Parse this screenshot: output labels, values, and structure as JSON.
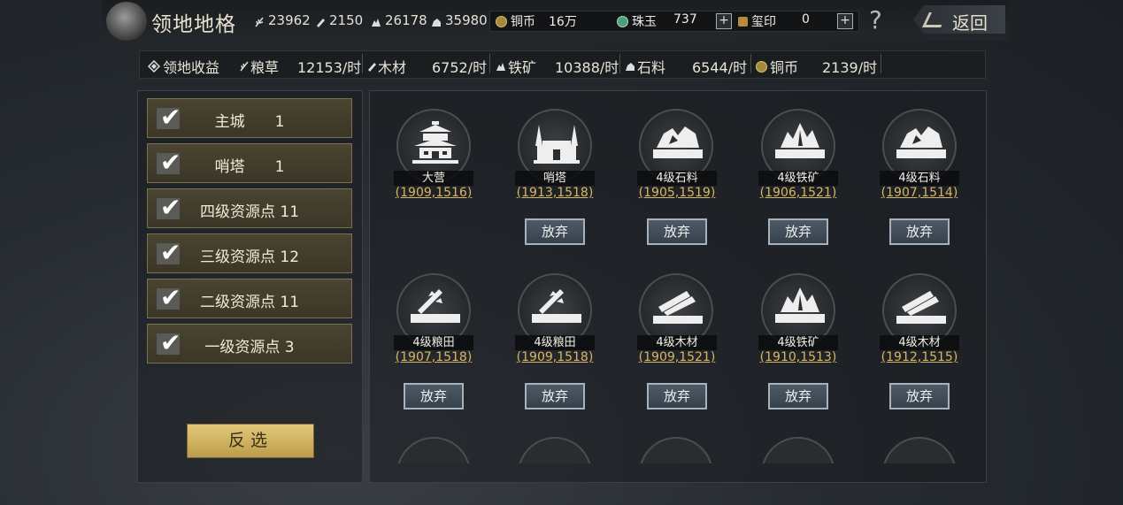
{
  "header": {
    "title": "领地地格",
    "back_label": "返回",
    "help": "?"
  },
  "resources": [
    {
      "icon": "grain-icon",
      "value": "23962"
    },
    {
      "icon": "wood-icon",
      "value": "2150"
    },
    {
      "icon": "iron-icon",
      "value": "26178"
    },
    {
      "icon": "stone-icon",
      "value": "35980"
    }
  ],
  "currencies": [
    {
      "icon": "copper-coin-icon",
      "label": "铜币",
      "value": "16万"
    },
    {
      "icon": "jade-icon",
      "label": "珠玉",
      "value": "737"
    },
    {
      "icon": "seal-icon",
      "label": "玺印",
      "value": "0"
    }
  ],
  "plus": "+",
  "income": {
    "title": "领地收益",
    "items": [
      {
        "icon": "grain-icon",
        "label": "粮草",
        "value": "12153/时"
      },
      {
        "icon": "wood-icon",
        "label": "木材",
        "value": "6752/时"
      },
      {
        "icon": "iron-icon",
        "label": "铁矿",
        "value": "10388/时"
      },
      {
        "icon": "stone-icon",
        "label": "石料",
        "value": "6544/时"
      },
      {
        "icon": "copper-coin-icon",
        "label": "铜币",
        "value": "2139/时"
      }
    ]
  },
  "filters": [
    {
      "label": "主城　　1",
      "checked": true
    },
    {
      "label": "哨塔　　1",
      "checked": true
    },
    {
      "label": "四级资源点 11",
      "checked": true
    },
    {
      "label": "三级资源点 12",
      "checked": true
    },
    {
      "label": "二级资源点 11",
      "checked": true
    },
    {
      "label": "一级资源点 3",
      "checked": true
    }
  ],
  "check_mark": "✔",
  "invert_label": "反选",
  "abandon_label": "放弃",
  "buildings": [
    {
      "name": "大营",
      "coord": "(1909,1516)",
      "icon": "camp-icon",
      "abandon": false
    },
    {
      "name": "哨塔",
      "coord": "(1913,1518)",
      "icon": "watchtower-icon",
      "abandon": true
    },
    {
      "name": "4级石料",
      "coord": "(1905,1519)",
      "icon": "stone-icon",
      "abandon": true
    },
    {
      "name": "4级铁矿",
      "coord": "(1906,1521)",
      "icon": "iron-icon",
      "abandon": true
    },
    {
      "name": "4级石料",
      "coord": "(1907,1514)",
      "icon": "stone-icon",
      "abandon": true
    },
    {
      "name": "4级粮田",
      "coord": "(1907,1518)",
      "icon": "grain-icon",
      "abandon": true
    },
    {
      "name": "4级粮田",
      "coord": "(1909,1518)",
      "icon": "grain-icon",
      "abandon": true
    },
    {
      "name": "4级木材",
      "coord": "(1909,1521)",
      "icon": "wood-icon",
      "abandon": true
    },
    {
      "name": "4级铁矿",
      "coord": "(1910,1513)",
      "icon": "iron-icon",
      "abandon": true
    },
    {
      "name": "4级木材",
      "coord": "(1912,1515)",
      "icon": "wood-icon",
      "abandon": true
    }
  ]
}
